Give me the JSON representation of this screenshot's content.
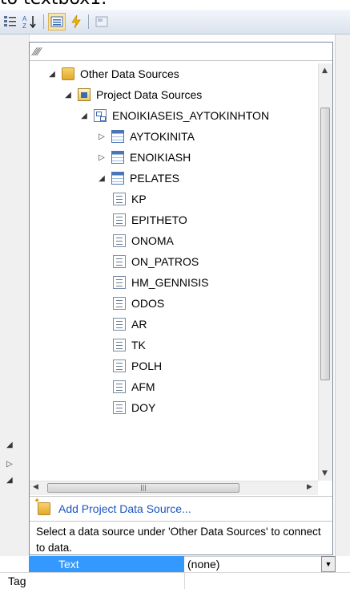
{
  "caption": "to textbox1.",
  "toolbar": {
    "buttons": [
      {
        "name": "categorized-icon",
        "glyph": "▤"
      },
      {
        "name": "alphabetical-sort-icon",
        "glyph": "A↓"
      },
      {
        "name": "properties-icon",
        "glyph": "▦"
      },
      {
        "name": "events-lightning-icon",
        "glyph": "⚡"
      },
      {
        "name": "property-pages-icon",
        "glyph": "▣"
      }
    ]
  },
  "tree": [
    {
      "label": "Other Data Sources",
      "level": 0,
      "expander": "open",
      "icon": "folder"
    },
    {
      "label": "Project Data Sources",
      "level": 1,
      "expander": "open",
      "icon": "proj"
    },
    {
      "label": "ENOIKIASEIS_AYTOKINHTON",
      "level": 2,
      "expander": "open",
      "icon": "ds"
    },
    {
      "label": "AYTOKINITA",
      "level": 3,
      "expander": "closed",
      "icon": "table"
    },
    {
      "label": "ENOIKIASH",
      "level": 3,
      "expander": "closed",
      "icon": "table"
    },
    {
      "label": "PELATES",
      "level": 3,
      "expander": "open",
      "icon": "table"
    },
    {
      "label": "KP",
      "level": 4,
      "expander": "none",
      "icon": "field"
    },
    {
      "label": "EPITHETO",
      "level": 4,
      "expander": "none",
      "icon": "field"
    },
    {
      "label": "ONOMA",
      "level": 4,
      "expander": "none",
      "icon": "field"
    },
    {
      "label": "ON_PATROS",
      "level": 4,
      "expander": "none",
      "icon": "field"
    },
    {
      "label": "HM_GENNISIS",
      "level": 4,
      "expander": "none",
      "icon": "field"
    },
    {
      "label": "ODOS",
      "level": 4,
      "expander": "none",
      "icon": "field"
    },
    {
      "label": "AR",
      "level": 4,
      "expander": "none",
      "icon": "field"
    },
    {
      "label": "TK",
      "level": 4,
      "expander": "none",
      "icon": "field"
    },
    {
      "label": "POLH",
      "level": 4,
      "expander": "none",
      "icon": "field"
    },
    {
      "label": "AFM",
      "level": 4,
      "expander": "none",
      "icon": "field"
    },
    {
      "label": "DOY",
      "level": 4,
      "expander": "none",
      "icon": "field"
    }
  ],
  "add_link": "Add Project Data Source...",
  "help_text": "Select a data source under 'Other Data Sources' to connect to data.",
  "property_rows": {
    "selected_name": "Text",
    "selected_value": "(none)",
    "next_name": "Tag"
  },
  "colors": {
    "selection": "#3399ff",
    "link": "#1a55c0"
  }
}
